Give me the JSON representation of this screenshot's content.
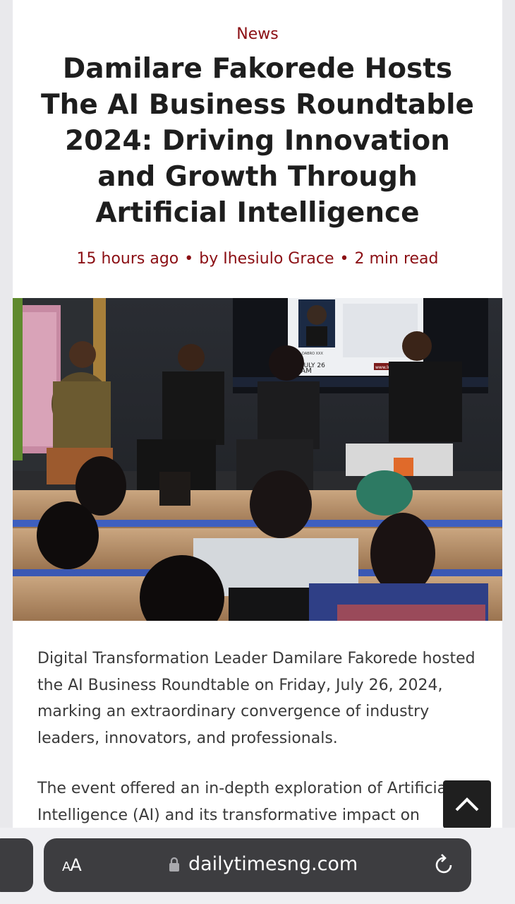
{
  "article": {
    "category": "News",
    "title": "Damilare Fakorede Hosts The AI Business Roundtable 2024: Driving Innovation and Growth Through Artificial Intelligence",
    "meta": {
      "time": "15 hours ago",
      "separator": "•",
      "author": "by Ihesiulo Grace",
      "read_time": "2 min read"
    },
    "image": {
      "screen": {
        "name": "DABRO XXX",
        "text": "JULY 26",
        "time": "0AM",
        "url": "www.lu.ma/"
      }
    },
    "paragraphs": [
      "Digital Transformation Leader Damilare Fakorede hosted the AI Business Roundtable on Friday, July 26, 2024, marking an extraordinary convergence of industry leaders, innovators, and professionals.",
      "The event offered an in-depth exploration of Artificial Intelligence (AI) and its transformative impact on"
    ]
  },
  "scroll_to_top": {
    "icon": "chevron-up-icon"
  },
  "browser": {
    "text_size_label_small": "A",
    "text_size_label_large": "A",
    "lock_icon": "lock-icon",
    "domain": "dailytimesng.com",
    "reload_icon": "reload-icon"
  }
}
